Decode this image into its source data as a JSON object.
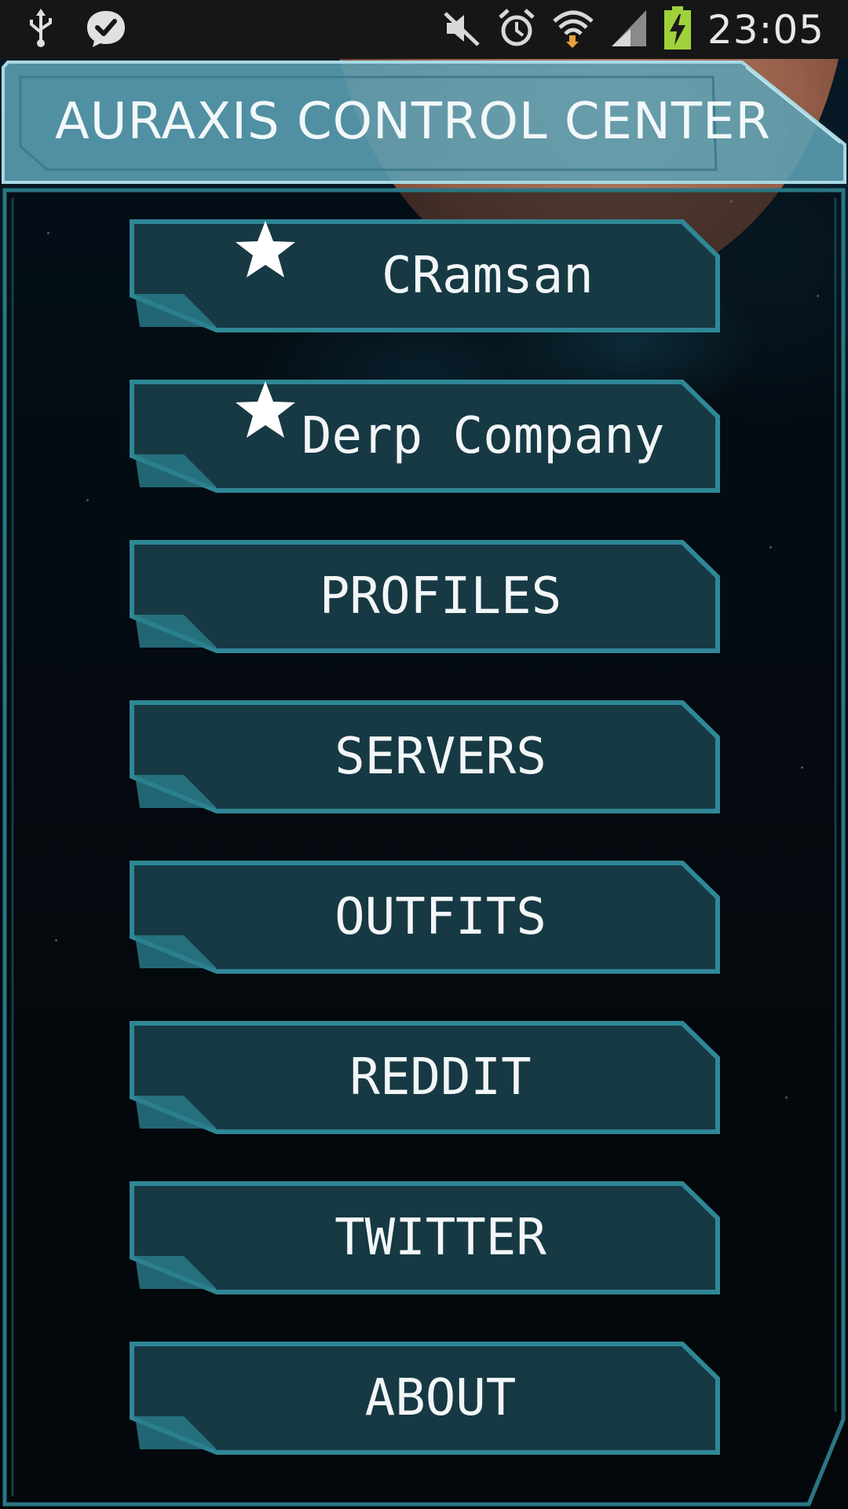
{
  "status_bar": {
    "time": "23:05",
    "icons_left": [
      "usb-icon",
      "messenger-check-icon"
    ],
    "icons_right": [
      "mute-icon",
      "alarm-icon",
      "wifi-icon",
      "signal-icon",
      "battery-charging-icon"
    ]
  },
  "header": {
    "title": "AURAXIS CONTROL CENTER"
  },
  "menu": {
    "items": [
      {
        "label": "CRamsan",
        "starred": true
      },
      {
        "label": "Derp Company",
        "starred": true
      },
      {
        "label": "PROFILES",
        "starred": false
      },
      {
        "label": "SERVERS",
        "starred": false
      },
      {
        "label": "OUTFITS",
        "starred": false
      },
      {
        "label": "REDDIT",
        "starred": false
      },
      {
        "label": "TWITTER",
        "starred": false
      },
      {
        "label": "ABOUT",
        "starred": false
      }
    ]
  },
  "colors": {
    "button_fill": "#163944",
    "button_border": "#2f8796",
    "header_fill": "#4f95a8",
    "frame_border": "#2a7684",
    "text": "#f3f6f7"
  }
}
